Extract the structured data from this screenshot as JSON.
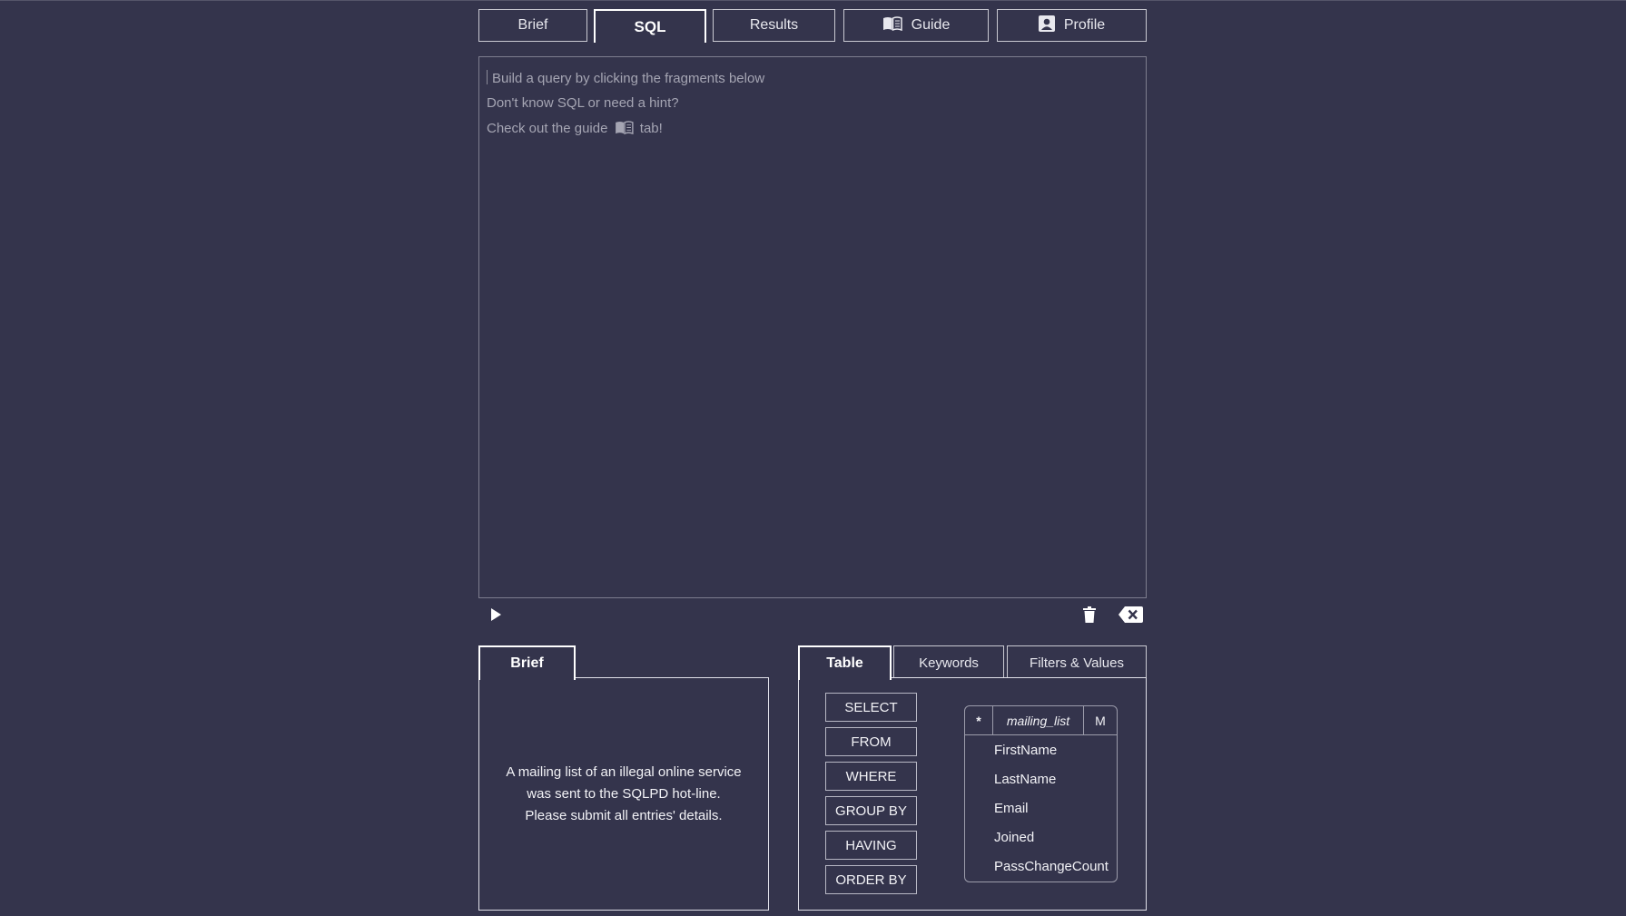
{
  "top_tabs": {
    "brief": "Brief",
    "sql": "SQL",
    "results": "Results",
    "guide": "Guide",
    "profile": "Profile"
  },
  "editor": {
    "line1": "Build a query by clicking the fragments below",
    "line2": "Don't know SQL or need a hint?",
    "line3_pre": "Check out the guide",
    "line3_post": "tab!"
  },
  "toolbar": {
    "run_icon": "play-icon",
    "trash_icon": "trash-icon",
    "backspace_icon": "backspace-icon"
  },
  "brief_panel": {
    "tab": "Brief",
    "text_line1": "A mailing list of an illegal online service",
    "text_line2": "was sent to the SQLPD hot-line.",
    "text_line3": "Please submit all entries' details."
  },
  "fragment_tabs": {
    "table": "Table",
    "keywords": "Keywords",
    "filters": "Filters & Values"
  },
  "keywords": [
    "SELECT",
    "FROM",
    "WHERE",
    "GROUP BY",
    "HAVING",
    "ORDER BY"
  ],
  "table": {
    "star": "*",
    "name": "mailing_list",
    "m": "M",
    "columns": [
      "FirstName",
      "LastName",
      "Email",
      "Joined",
      "PassChangeCount"
    ]
  }
}
